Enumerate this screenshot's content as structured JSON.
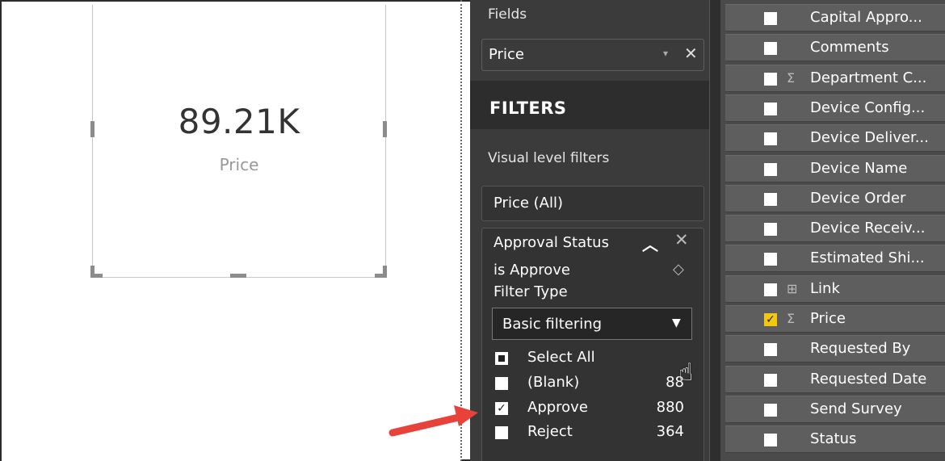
{
  "card_visual": {
    "value": "89.21K",
    "label": "Price"
  },
  "filter_pane": {
    "fields_label": "Fields",
    "field_well": {
      "value": "Price",
      "chevron": "▾",
      "remove": "✕"
    },
    "filters_title": "FILTERS",
    "visual_level_label": "Visual level filters",
    "price_filter": "Price  (All)",
    "approval_filter": {
      "title": "Approval Status",
      "collapse_glyph": "︿",
      "remove_glyph": "✕",
      "condition": "is Approve",
      "eraser_glyph": "◇",
      "filter_type_label": "Filter Type",
      "filter_type_value": "Basic filtering",
      "dropdown_arrow": "▼",
      "options": [
        {
          "label": "Select All",
          "count": "",
          "state": "partial"
        },
        {
          "label": "(Blank)",
          "count": "88",
          "state": "unchecked"
        },
        {
          "label": "Approve",
          "count": "880",
          "state": "checked"
        },
        {
          "label": "Reject",
          "count": "364",
          "state": "unchecked"
        }
      ]
    }
  },
  "field_list": [
    {
      "label": "Capital Appro...",
      "icon": "",
      "checked": false
    },
    {
      "label": "Comments",
      "icon": "",
      "checked": false
    },
    {
      "label": "Department C...",
      "icon": "Σ",
      "checked": false
    },
    {
      "label": "Device Config...",
      "icon": "",
      "checked": false
    },
    {
      "label": "Device Deliver...",
      "icon": "",
      "checked": false
    },
    {
      "label": "Device Name",
      "icon": "",
      "checked": false
    },
    {
      "label": "Device Order",
      "icon": "",
      "checked": false
    },
    {
      "label": "Device Receiv...",
      "icon": "",
      "checked": false
    },
    {
      "label": "Estimated Shi...",
      "icon": "",
      "checked": false
    },
    {
      "label": "Link",
      "icon": "⊞",
      "checked": false
    },
    {
      "label": "Price",
      "icon": "Σ",
      "checked": true
    },
    {
      "label": "Requested By",
      "icon": "",
      "checked": false
    },
    {
      "label": "Requested Date",
      "icon": "",
      "checked": false
    },
    {
      "label": "Send Survey",
      "icon": "",
      "checked": false
    },
    {
      "label": "Status",
      "icon": "",
      "checked": false
    }
  ],
  "icons": {
    "cursor": "hand-pointer-icon",
    "annotation": "red-arrow"
  },
  "colors": {
    "panel": "#3b3b3b",
    "accent_check": "#f2c811",
    "arrow": "#e8433a"
  }
}
